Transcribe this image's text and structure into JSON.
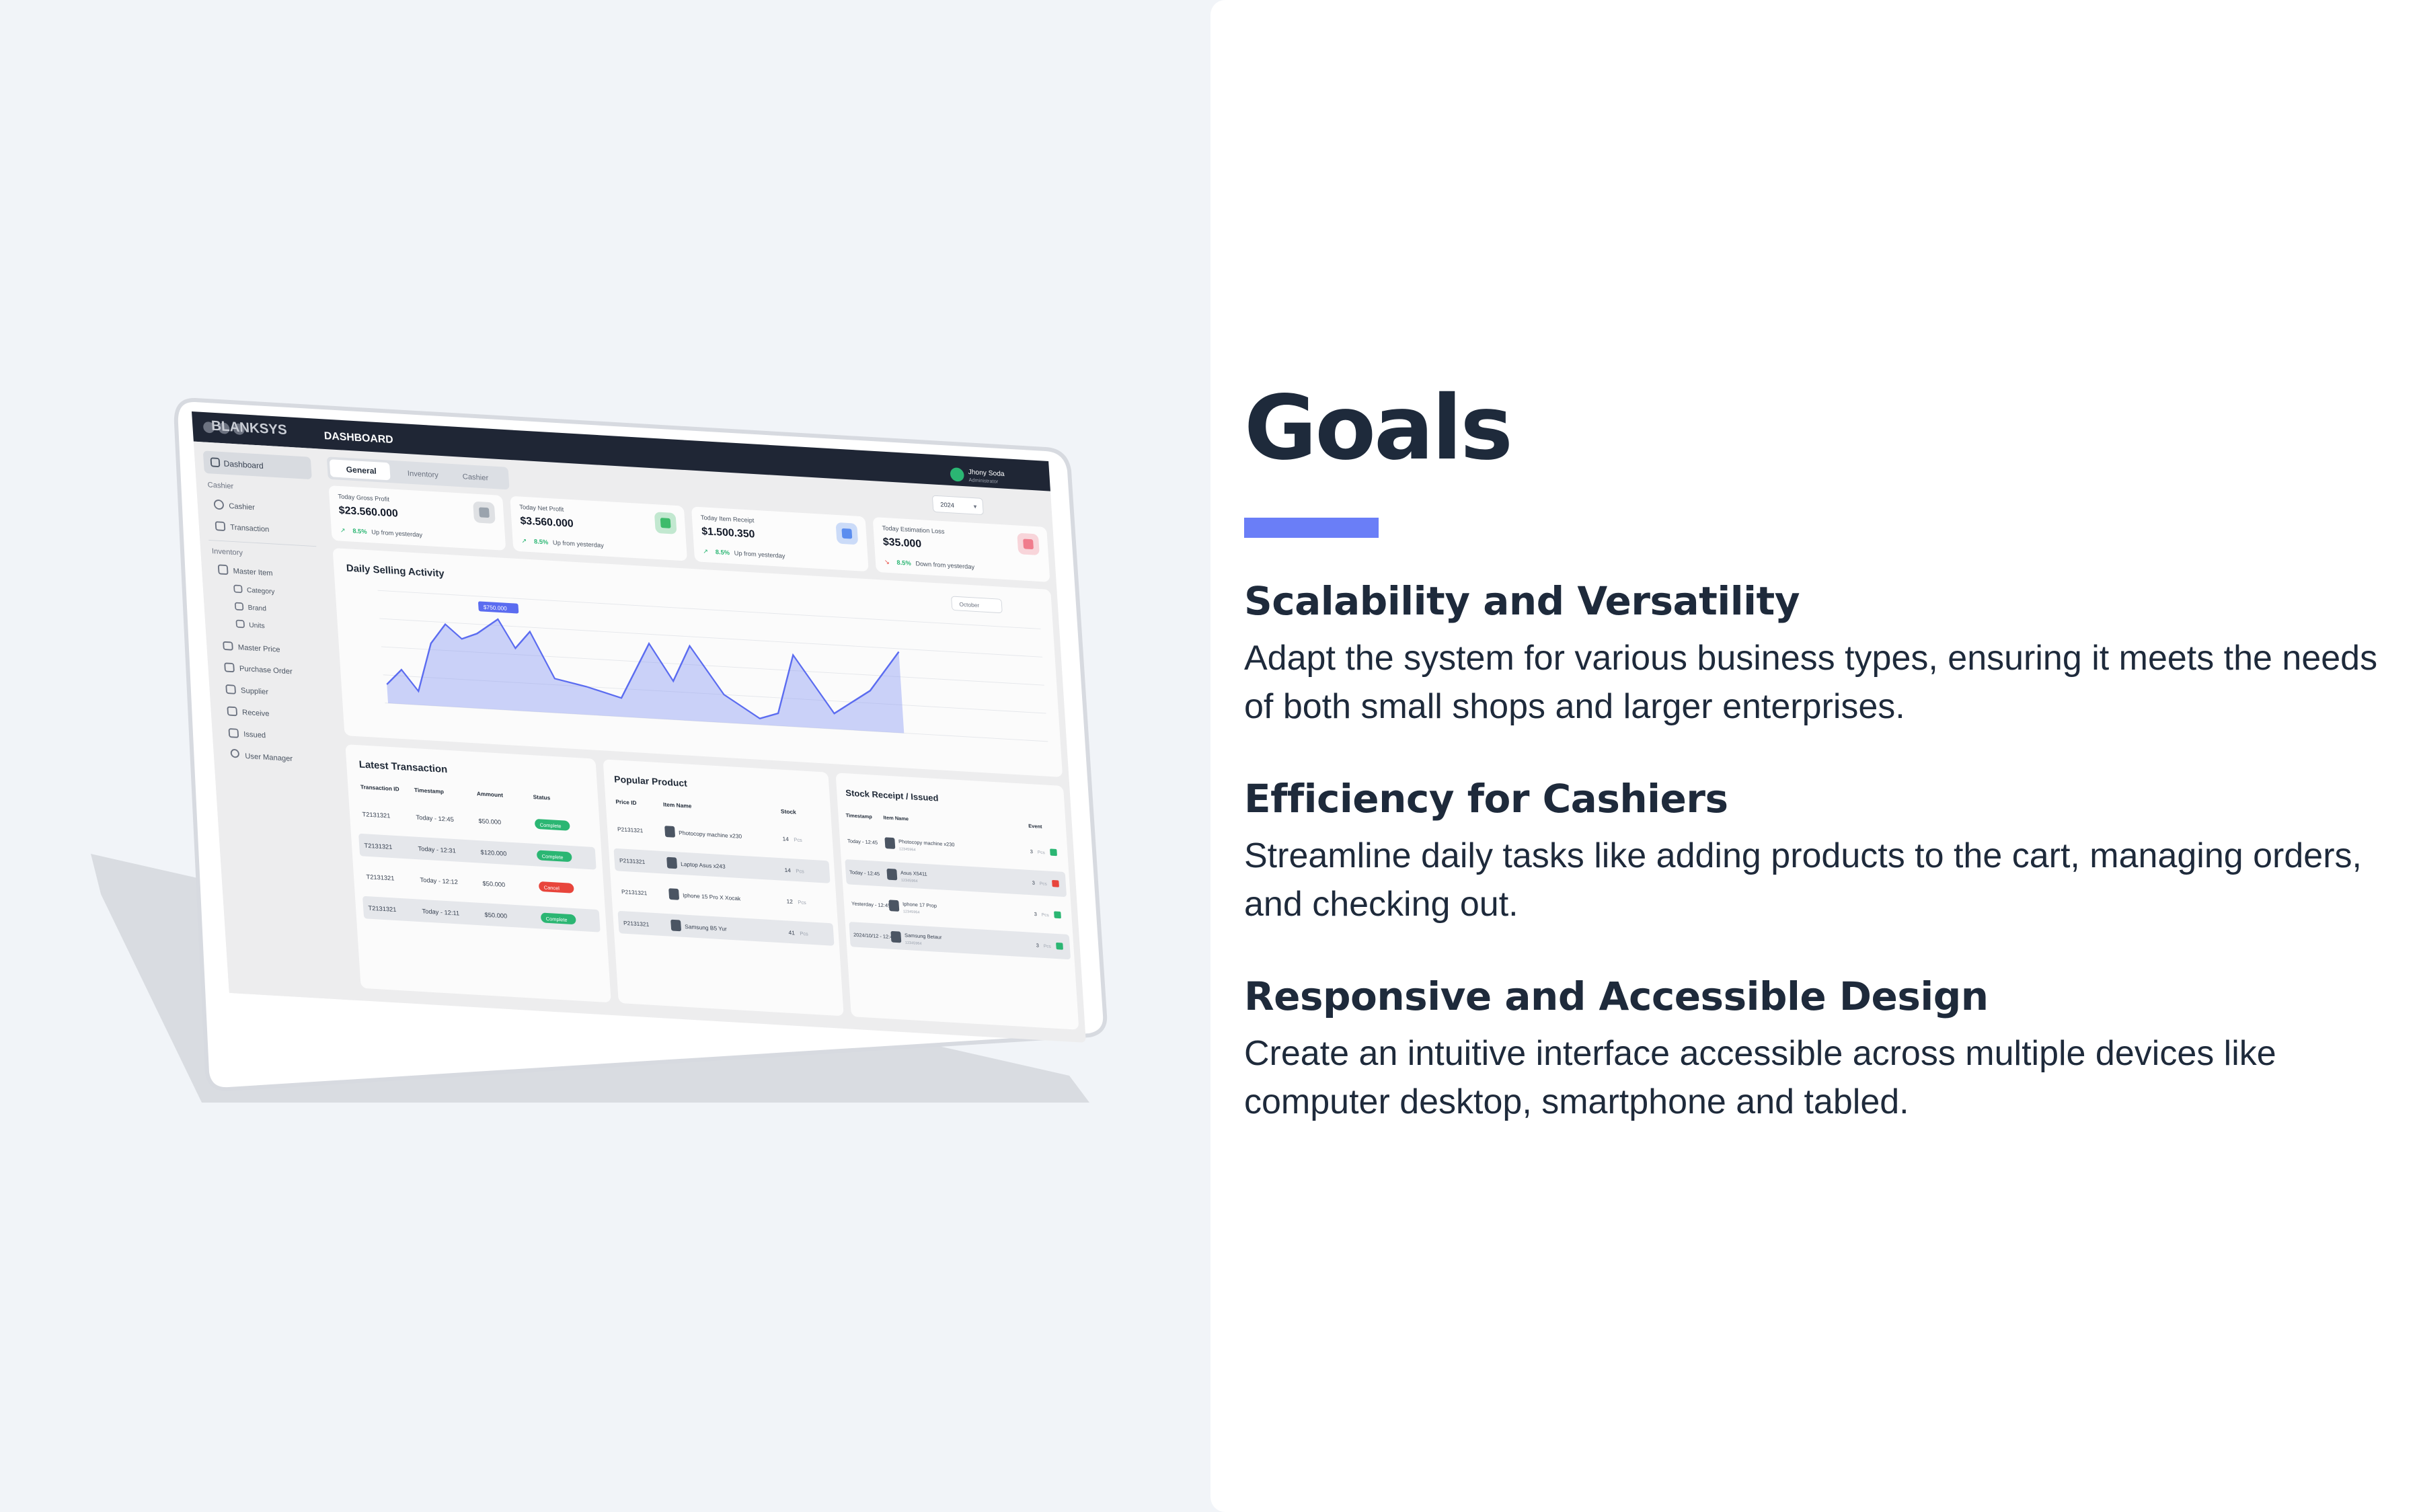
{
  "goals": {
    "title": "Goals",
    "accent_color": "#6a7ef7",
    "items": [
      {
        "heading": "Scalability and Versatility",
        "text": "Adapt the system for various business types, ensuring it meets the needs of both small shops and larger enterprises."
      },
      {
        "heading": "Efficiency for Cashiers",
        "text": "Streamline daily tasks like adding products to the cart, managing orders, and checking out."
      },
      {
        "heading": "Responsive and Accessible Design",
        "text": "Create an intuitive interface accessible across multiple devices like computer desktop, smartphone and tabled."
      }
    ]
  },
  "dashboard": {
    "brand": "BLANKSYS",
    "header_title": "DASHBOARD",
    "user": {
      "name": "Jhony Soda",
      "role": "Administrator"
    },
    "tabs": [
      "General",
      "Inventory",
      "Cashier"
    ],
    "year_select": "2024",
    "sidebar": {
      "dashboard": "Dashboard",
      "section_cashier": "Cashier",
      "cashier": "Cashier",
      "transaction": "Transaction",
      "section_inventory": "Inventory",
      "master_item": "Master Item",
      "category": "Category",
      "brand": "Brand",
      "units": "Units",
      "master_price": "Master Price",
      "purchase_order": "Purchase Order",
      "supplier": "Supplier",
      "receive": "Receive",
      "issued": "Issued",
      "user_manager": "User Manager"
    },
    "stats": [
      {
        "label": "Today Gross Profit",
        "value": "$23.560.000",
        "change": "8.5%",
        "note": "Up from yesterday",
        "color": "#9aa3ad",
        "trend": "up"
      },
      {
        "label": "Today Net Profit",
        "value": "$3.560.000",
        "change": "8.5%",
        "note": "Up from yesterday",
        "color": "#3dbb6b",
        "trend": "up"
      },
      {
        "label": "Today Item Receipt",
        "value": "$1.500.350",
        "change": "8.5%",
        "note": "Up from yesterday",
        "color": "#5b8def",
        "trend": "up"
      },
      {
        "label": "Today Estimation Loss",
        "value": "$35.000",
        "change": "8.5%",
        "note": "Down from yesterday",
        "color": "#f07c8c",
        "trend": "down"
      }
    ],
    "activity": {
      "title": "Daily Selling Activity",
      "tooltip": "$750.000",
      "select": "October"
    },
    "latest_transaction": {
      "title": "Latest Transaction",
      "columns": [
        "Transaction ID",
        "Timestamp",
        "Ammount",
        "Status"
      ],
      "rows": [
        {
          "id": "T2131321",
          "time": "Today - 12:45",
          "amount": "$50.000",
          "status": "Complete",
          "status_color": "#2bb673"
        },
        {
          "id": "T2131321",
          "time": "Today - 12:31",
          "amount": "$120.000",
          "status": "Complete",
          "status_color": "#2bb673"
        },
        {
          "id": "T2131321",
          "time": "Today - 12:12",
          "amount": "$50.000",
          "status": "Cancel",
          "status_color": "#e8453c"
        },
        {
          "id": "T2131321",
          "time": "Today - 12:11",
          "amount": "$50.000",
          "status": "Complete",
          "status_color": "#2bb673"
        }
      ]
    },
    "popular_product": {
      "title": "Popular Product",
      "columns": [
        "Price ID",
        "Item Name",
        "Stock"
      ],
      "rows": [
        {
          "id": "P2131321",
          "name": "Photocopy machine x230",
          "stock": "14",
          "unit": "Pcs"
        },
        {
          "id": "P2131321",
          "name": "Laptop Asus x243",
          "stock": "14",
          "unit": "Pcs"
        },
        {
          "id": "P2131321",
          "name": "Iphone 15 Pro X Xocak",
          "stock": "12",
          "unit": "Pcs"
        },
        {
          "id": "P2131321",
          "name": "Samsung B5 Yur",
          "stock": "41",
          "unit": "Pcs"
        }
      ]
    },
    "stock_receipt": {
      "title": "Stock Receipt / Issued",
      "columns": [
        "Timestamp",
        "Item Name",
        "Event"
      ],
      "rows": [
        {
          "time": "Today - 12:45",
          "name": "Photocopy machine x230",
          "sub": "12345964",
          "qty": "3",
          "unit": "Pcs",
          "color": "#2bb673"
        },
        {
          "time": "Today - 12:45",
          "name": "Asus X5411",
          "sub": "12345964",
          "qty": "3",
          "unit": "Pcs",
          "color": "#e8453c"
        },
        {
          "time": "Yesterday - 12:45",
          "name": "Iphone 17 Prop",
          "sub": "12345964",
          "qty": "3",
          "unit": "Pcs",
          "color": "#2bb673"
        },
        {
          "time": "2024/10/12 - 12:45",
          "name": "Samsung Betaur",
          "sub": "12345964",
          "qty": "3",
          "unit": "Pcs",
          "color": "#2bb673"
        }
      ]
    }
  }
}
